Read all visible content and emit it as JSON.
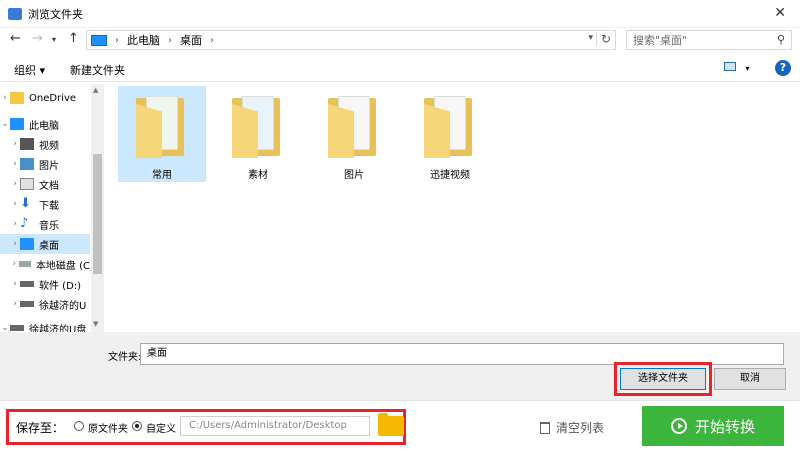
{
  "window": {
    "title": "浏览文件夹"
  },
  "addressbar": {
    "crumbs": [
      "此电脑",
      "桌面"
    ]
  },
  "search": {
    "placeholder": "搜索\"桌面\""
  },
  "toolbar": {
    "organize": "组织 ▾",
    "new_folder": "新建文件夹",
    "help": "?"
  },
  "nav": {
    "items": [
      {
        "label": "OneDrive"
      },
      {
        "label": "此电脑"
      },
      {
        "label": "视频"
      },
      {
        "label": "图片"
      },
      {
        "label": "文档"
      },
      {
        "label": "下载"
      },
      {
        "label": "音乐"
      },
      {
        "label": "桌面"
      },
      {
        "label": "本地磁盘 (C"
      },
      {
        "label": "软件 (D:)"
      },
      {
        "label": "徐越济的U"
      },
      {
        "label": "徐越济的U盘"
      }
    ]
  },
  "folders": [
    {
      "label": "常用"
    },
    {
      "label": "素材"
    },
    {
      "label": "图片"
    },
    {
      "label": "迅捷视频"
    }
  ],
  "bottom": {
    "folder_label": "文件夹:",
    "folder_value": "桌面",
    "select_button": "选择文件夹",
    "cancel_button": "取消"
  },
  "app": {
    "save_to": "保存至：",
    "radio_original": "原文件夹",
    "radio_custom": "自定义",
    "path": "C:/Users/Administrator/Desktop",
    "clear_list": "清空列表",
    "start": "开始转换"
  }
}
